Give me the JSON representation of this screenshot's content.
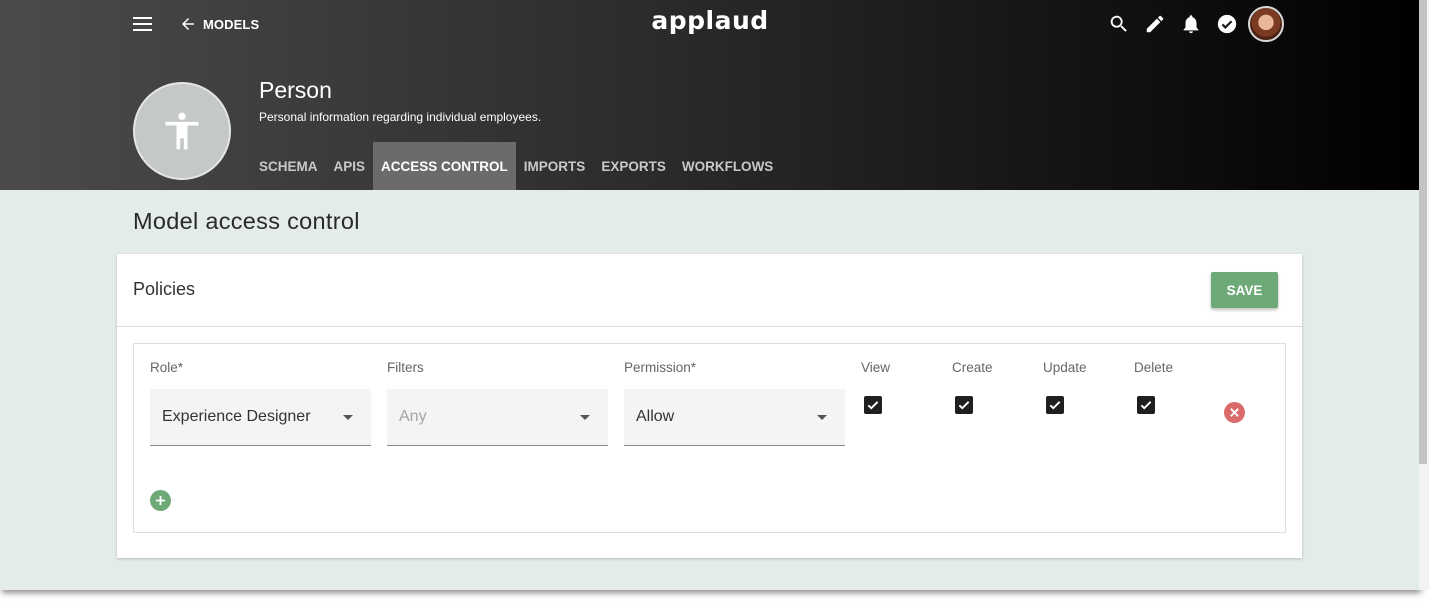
{
  "header": {
    "back_label": "MODELS",
    "logo": "applaud",
    "icons": [
      "menu-icon",
      "arrow-left-icon",
      "search-icon",
      "pencil-icon",
      "bell-icon",
      "check-circle-icon",
      "avatar"
    ]
  },
  "model": {
    "title": "Person",
    "description": "Personal information regarding individual employees.",
    "icon": "person-icon"
  },
  "tabs": [
    {
      "label": "SCHEMA"
    },
    {
      "label": "APIS"
    },
    {
      "label": "ACCESS CONTROL"
    },
    {
      "label": "IMPORTS"
    },
    {
      "label": "EXPORTS"
    },
    {
      "label": "WORKFLOWS"
    }
  ],
  "active_tab": "ACCESS CONTROL",
  "page": {
    "title": "Model access control"
  },
  "policies": {
    "title": "Policies",
    "save_label": "SAVE",
    "columns": {
      "role": "Role*",
      "filters": "Filters",
      "permission": "Permission*",
      "view": "View",
      "create": "Create",
      "update": "Update",
      "delete": "Delete"
    },
    "rows": [
      {
        "role": "Experience Designer",
        "filters_placeholder": "Any",
        "permission": "Allow",
        "view": true,
        "create": true,
        "update": true,
        "delete": true
      }
    ]
  },
  "colors": {
    "save_button": "#6eaa77",
    "add_button": "#6eaa77",
    "remove_button": "#db6b6b",
    "page_background": "#e3ebeb",
    "active_tab": "#6b6b6b"
  }
}
